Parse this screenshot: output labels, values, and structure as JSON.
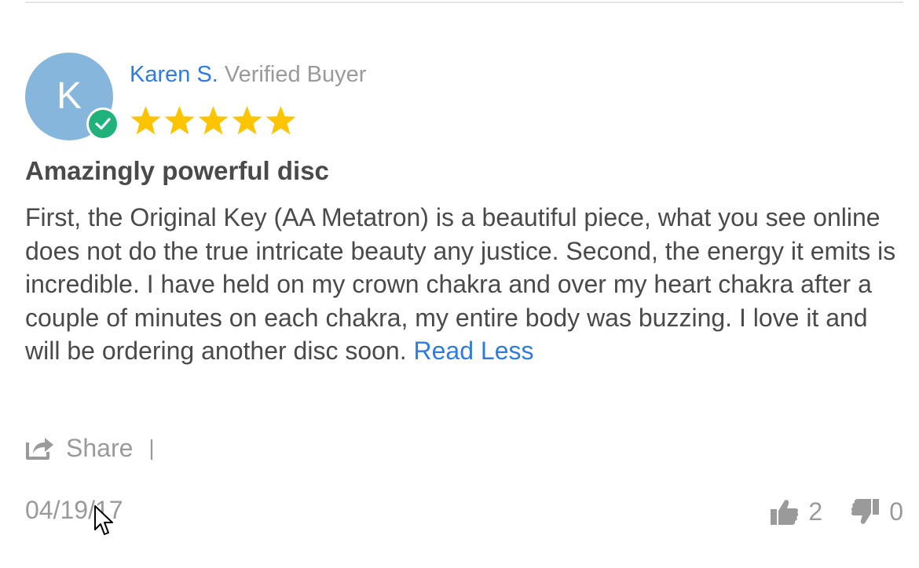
{
  "reviewer": {
    "avatar_initial": "K",
    "name": "Karen S.",
    "status": "Verified Buyer",
    "rating": 5,
    "rating_max": 5
  },
  "review": {
    "title": "Amazingly powerful disc",
    "body": "First, the Original Key (AA Metatron) is a beautiful piece, what you see online does not do the true intricate beauty any justice. Second, the energy it emits is incredible. I have held on my crown chakra and over my heart chakra after a couple of minutes on each chakra, my entire body was buzzing. I love it and will be ordering another disc soon.",
    "read_less_label": "Read Less"
  },
  "actions": {
    "share_label": "Share",
    "separator": "|"
  },
  "footer": {
    "date": "04/19/17",
    "upvotes": "2",
    "downvotes": "0"
  },
  "icons": {
    "verified": "check-circle-icon",
    "star": "star-icon",
    "share": "share-icon",
    "upvote": "thumbs-up-icon",
    "downvote": "thumbs-down-icon",
    "cursor": "mouse-pointer-icon"
  },
  "colors": {
    "accent": "#2f7ce0",
    "avatar": "#87b6dd",
    "verified": "#20b27a",
    "star": "#ffc400",
    "muted": "#9a9a9a",
    "text": "#4a4a4a"
  }
}
